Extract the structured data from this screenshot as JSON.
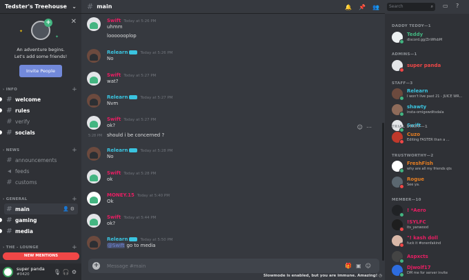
{
  "server": {
    "name": "Tedster's Treehouse"
  },
  "invite_card": {
    "line1": "An adventure begins.",
    "line2": "Let's add some friends!",
    "button": "Invite People"
  },
  "categories": [
    {
      "label": "INFO",
      "channels": [
        "welcome",
        "rules",
        "verify",
        "socials"
      ]
    },
    {
      "label": "NEWS",
      "channels": [
        "announcements",
        "feeds",
        "customs"
      ]
    },
    {
      "label": "GENERAL",
      "channels": [
        "main",
        "gaming",
        "media"
      ]
    },
    {
      "label": "THE - LOUNGE",
      "channels": []
    }
  ],
  "new_mentions": "NEW MENTIONS",
  "user": {
    "name": "super panda",
    "tag": "#0420"
  },
  "channel": {
    "name": "main"
  },
  "search": {
    "placeholder": "Search"
  },
  "messages": [
    {
      "author": "Swift",
      "time": "Today at 5:26 PM",
      "lines": [
        "uhmm",
        "looooooplop"
      ],
      "color": "#e91e63"
    },
    {
      "author": "Relearn",
      "time": "Today at 5:26 PM",
      "lines": [
        "No"
      ],
      "color": "#3ac4e0"
    },
    {
      "author": "Swift",
      "time": "Today at 5:27 PM",
      "lines": [
        "wat?"
      ],
      "color": "#e91e63"
    },
    {
      "author": "Relearn",
      "time": "Today at 5:27 PM",
      "lines": [
        "Nvm"
      ],
      "color": "#3ac4e0"
    },
    {
      "author": "Swift",
      "time": "Today at 5:27 PM",
      "lines": [
        "ok?"
      ],
      "color": "#e91e63"
    },
    {
      "author": "Relearn",
      "time": "Today at 5:28 PM",
      "lines": [
        "No"
      ],
      "color": "#3ac4e0"
    },
    {
      "author": "Swift",
      "time": "Today at 5:28 PM",
      "lines": [
        "ok"
      ],
      "color": "#e91e63"
    },
    {
      "author": "MONEY.15",
      "time": "Today at 5:40 PM",
      "lines": [
        "Ok"
      ],
      "color": "#e91e63"
    },
    {
      "author": "Swift",
      "time": "Today at 5:44 PM",
      "lines": [
        "ok?"
      ],
      "color": "#e91e63"
    },
    {
      "author": "Relearn",
      "time": "Today at 5:50 PM",
      "lines": [
        "go to media"
      ],
      "color": "#3ac4e0",
      "mention": "@Swift"
    }
  ],
  "continued": {
    "time": "5:28 PM",
    "text": "should i be concerned ?"
  },
  "composer": {
    "placeholder": "Message #main"
  },
  "slowmode": "Slowmode is enabled, but you are immune. Amazing!",
  "members": {
    "groups": [
      {
        "label": "DADDY TEDDY—1",
        "members": [
          {
            "name": "Teddy",
            "status": "discord.gg/ZnWfsbM",
            "color": "#43b581"
          }
        ]
      },
      {
        "label": "ADMINS—1",
        "members": [
          {
            "name": "super panda",
            "status": "",
            "color": "#f04747"
          }
        ]
      },
      {
        "label": "STAFF—3",
        "members": [
          {
            "name": "Relearn",
            "status": "I won't live past 21 - JUICE WR...",
            "color": "#3ac4e0"
          },
          {
            "name": "shawty",
            "status": "insta-omigewditsdala",
            "color": "#3ac4e0"
          },
          {
            "name": "Swift",
            "status": "",
            "color": "#3ac4e0"
          }
        ]
      },
      {
        "label": "TRIAL STAFF—1",
        "members": [
          {
            "name": "Cuzo",
            "status": "Editing FASTER than a ...",
            "color": "#e67e22"
          }
        ]
      },
      {
        "label": "TRUSTWORTHY—2",
        "members": [
          {
            "name": "FreshFish",
            "status": "why are all my friends qts",
            "color": "#e67e22"
          },
          {
            "name": "Rogue",
            "status": "See ya.",
            "color": "#e67e22"
          }
        ]
      },
      {
        "label": "MEMBER—10",
        "members": [
          {
            "name": "! *Aero",
            "status": "",
            "color": "#e91e63"
          },
          {
            "name": "!SYLFC",
            "status": "its_yanwood",
            "color": "#e91e63"
          },
          {
            "name": "\"! kash doll",
            "status": "fuck it #onenfakind",
            "color": "#e91e63"
          },
          {
            "name": "Aspxcts",
            "status": "",
            "color": "#e91e63"
          },
          {
            "name": "Djwolf17",
            "status": "DM me for server invite",
            "color": "#e91e63"
          }
        ]
      }
    ]
  }
}
